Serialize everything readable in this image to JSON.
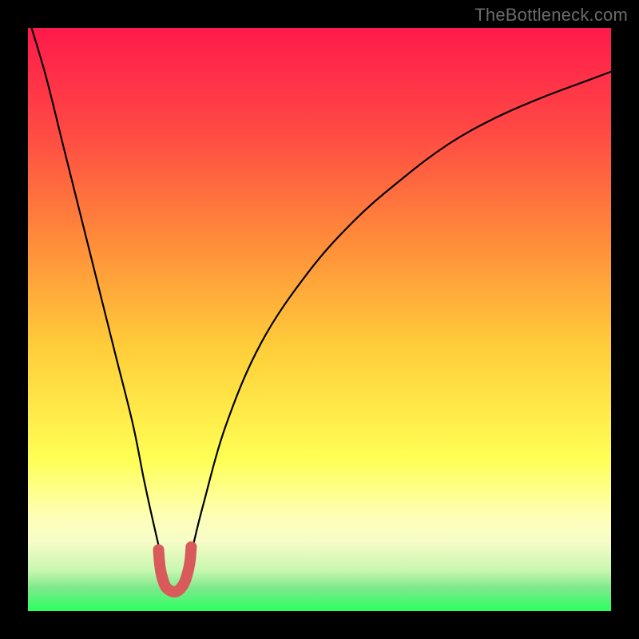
{
  "watermark": "TheBottleneck.com",
  "chart_data": {
    "type": "line",
    "title": "",
    "xlabel": "",
    "ylabel": "",
    "xlim": [
      0,
      100
    ],
    "ylim": [
      0,
      100
    ],
    "grid": false,
    "legend": false,
    "background_gradient": {
      "top": "#ff1a4b",
      "mid_upper": "#ff7a3a",
      "mid": "#ffd23a",
      "mid_lower": "#ffff66",
      "lower_band": "#fafca0",
      "green_band": "#5fe27a",
      "bottom": "#2aff60"
    },
    "series": [
      {
        "name": "bottleneck-curve",
        "x": [
          0,
          3,
          6,
          9,
          12,
          15,
          18,
          20,
          22,
          23.5,
          25,
          26.5,
          28,
          30,
          34,
          40,
          48,
          56,
          64,
          72,
          80,
          88,
          96,
          100
        ],
        "y": [
          102,
          92,
          80,
          68,
          56,
          44,
          32,
          22,
          13,
          7,
          3,
          5,
          10,
          18,
          32,
          46,
          58,
          67,
          74,
          80,
          84.5,
          88,
          91,
          92.5
        ]
      },
      {
        "name": "ideal-zone-marker",
        "x": [
          22.4,
          22.6,
          23.0,
          23.6,
          24.4,
          25.2,
          26.0,
          26.8,
          27.4,
          27.8,
          28.0
        ],
        "y": [
          10.5,
          8.0,
          5.8,
          4.2,
          3.5,
          3.3,
          3.7,
          4.8,
          6.6,
          8.6,
          11.0
        ]
      }
    ],
    "curve_color": "#000000",
    "marker_color": "#d85a5a",
    "marker_width_px": 14
  }
}
